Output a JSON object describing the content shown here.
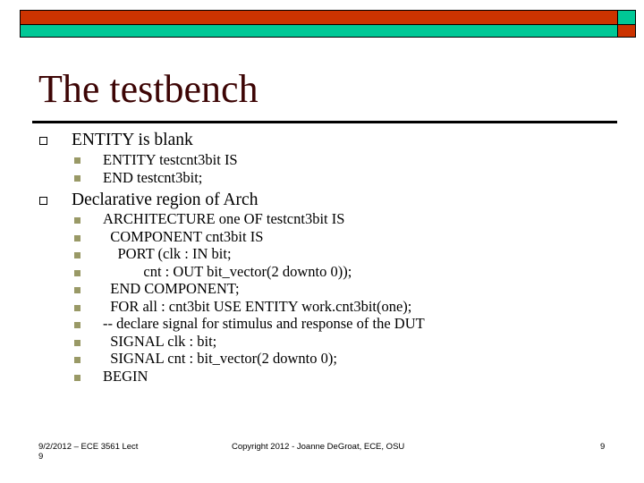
{
  "slide": {
    "title": "The testbench",
    "banner_colors": {
      "primary": "#cc3300",
      "secondary": "#00c896",
      "border": "#000000"
    },
    "bullet_color": "#999966",
    "title_color": "#3d0505",
    "items": [
      {
        "text": "ENTITY is blank",
        "subitems": [
          "ENTITY testcnt3bit IS",
          "END testcnt3bit;"
        ]
      },
      {
        "text": "Declarative region of Arch",
        "subitems": [
          "ARCHITECTURE one OF testcnt3bit IS",
          "  COMPONENT cnt3bit IS",
          "    PORT (clk : IN bit;",
          "           cnt : OUT bit_vector(2 downto 0));",
          "  END COMPONENT;",
          "  FOR all : cnt3bit USE ENTITY work.cnt3bit(one);",
          "-- declare signal for stimulus and response of the DUT",
          "  SIGNAL clk : bit;",
          "  SIGNAL cnt : bit_vector(2 downto 0);",
          "BEGIN"
        ]
      }
    ]
  },
  "footer": {
    "left_line1": "9/2/2012 – ECE 3561 Lect",
    "left_line2": "9",
    "center": "Copyright 2012 - Joanne DeGroat, ECE, OSU",
    "page_number": "9"
  }
}
